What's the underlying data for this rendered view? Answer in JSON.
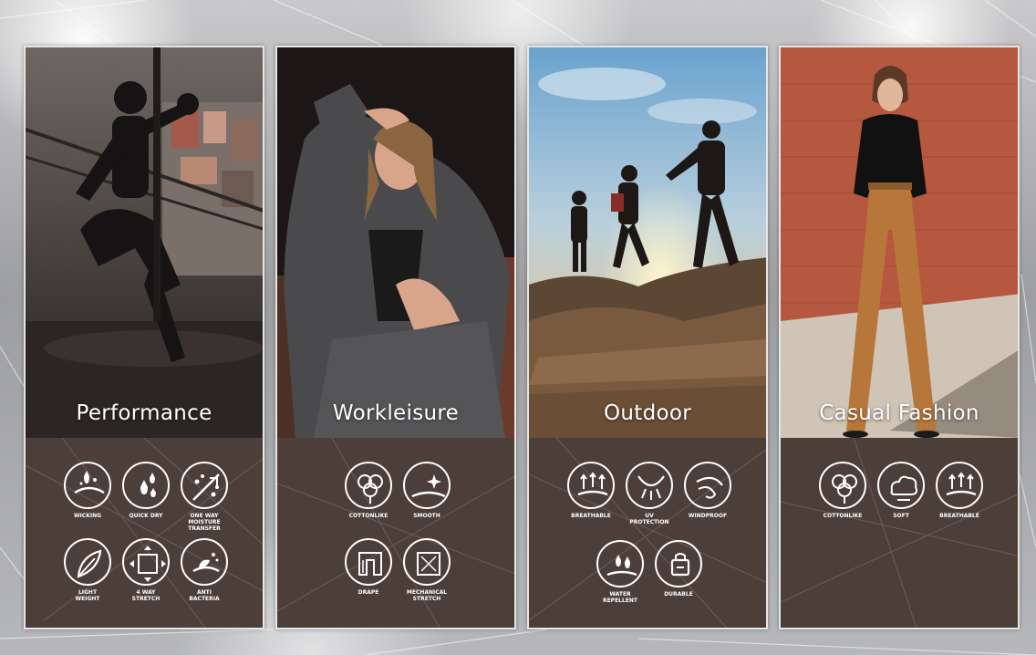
{
  "panels": [
    {
      "title": "Performance",
      "features": [
        {
          "icon": "wicking-icon",
          "label": "WICKING"
        },
        {
          "icon": "quick-dry-icon",
          "label": "QUICK DRY"
        },
        {
          "icon": "moisture-transfer-icon",
          "label": "ONE WAY\nMOISTURE\nTRANSFER"
        },
        {
          "icon": "feather-icon",
          "label": "LIGHT\nWEIGHT"
        },
        {
          "icon": "stretch-icon",
          "label": "4 WAY\nSTRETCH"
        },
        {
          "icon": "anti-bacteria-icon",
          "label": "ANTI\nBACTERIA"
        }
      ]
    },
    {
      "title": "Workleisure",
      "features": [
        {
          "icon": "cotton-icon",
          "label": "COTTONLIKE"
        },
        {
          "icon": "smooth-icon",
          "label": "SMOOTH"
        },
        {
          "icon": "drape-icon",
          "label": "DRAPE"
        },
        {
          "icon": "mechanical-stretch-icon",
          "label": "MECHANICAL\nSTRETCH"
        }
      ]
    },
    {
      "title": "Outdoor",
      "features": [
        {
          "icon": "breathable-icon",
          "label": "BREATHABLE"
        },
        {
          "icon": "uv-protection-icon",
          "label": "UV\nPROTECTION"
        },
        {
          "icon": "windproof-icon",
          "label": "WINDPROOF"
        },
        {
          "icon": "water-repellent-icon",
          "label": "WATER\nREPELLENT"
        },
        {
          "icon": "durable-icon",
          "label": "DURABLE"
        }
      ]
    },
    {
      "title": "Casual Fashion",
      "features": [
        {
          "icon": "cotton-icon",
          "label": "COTTONLIKE"
        },
        {
          "icon": "soft-icon",
          "label": "SOFT"
        },
        {
          "icon": "breathable-icon",
          "label": "BREATHABLE"
        }
      ]
    }
  ]
}
